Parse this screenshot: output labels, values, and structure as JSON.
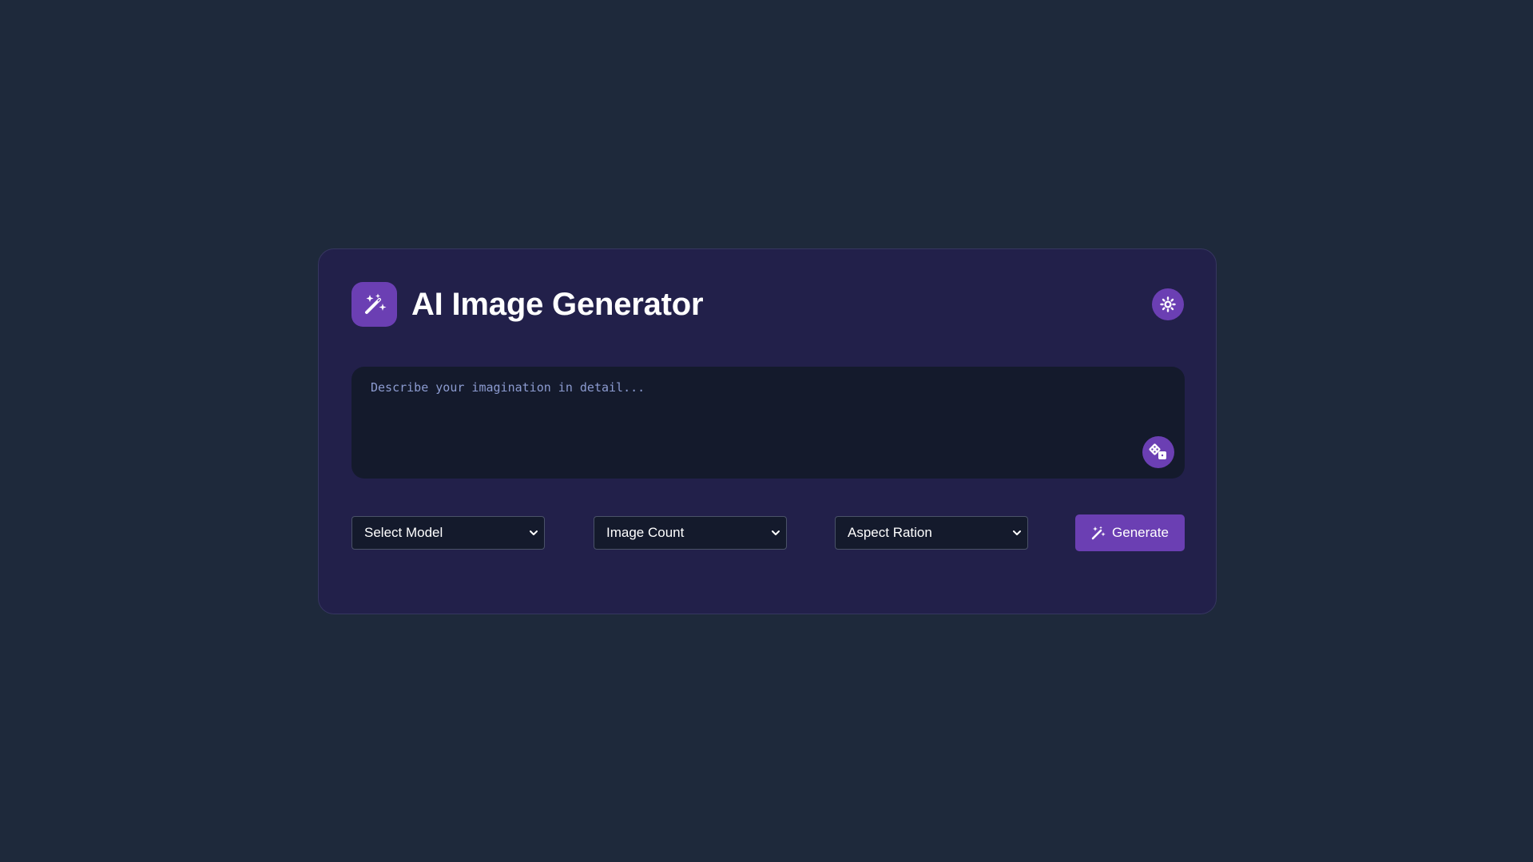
{
  "app": {
    "title": "AI Image Generator",
    "logo_icon": "magic-wand-sparkles-icon",
    "theme_toggle_icon": "sun-icon"
  },
  "prompt": {
    "placeholder": "Describe your imagination in detail...",
    "value": "",
    "random_button_icon": "dice-icon"
  },
  "controls": {
    "model_select": {
      "selected": "Select Model"
    },
    "count_select": {
      "selected": "Image Count"
    },
    "ratio_select": {
      "selected": "Aspect Ration"
    },
    "generate_label": "Generate",
    "generate_icon": "magic-wand-icon"
  },
  "colors": {
    "background": "#1e293b",
    "card": "#22204a",
    "accent": "#6b3fb3",
    "input_bg": "#141a2c",
    "placeholder": "#8c9bd0"
  }
}
